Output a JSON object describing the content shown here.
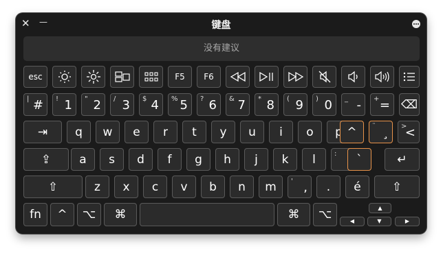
{
  "window": {
    "title": "键盘",
    "close_glyph": "✕",
    "minimize_glyph": "—"
  },
  "suggestion_bar": {
    "text": "没有建议"
  },
  "function_row": {
    "esc": "esc",
    "f5": "F5",
    "f6": "F6",
    "icons": [
      "brightness-down-icon",
      "brightness-up-icon",
      "mission-control-icon",
      "launchpad-icon",
      "rewind-icon",
      "play-pause-icon",
      "fast-forward-icon",
      "mute-icon",
      "volume-down-icon",
      "volume-up-icon",
      "list-icon"
    ]
  },
  "number_row": [
    {
      "sec": "|",
      "pri": "#"
    },
    {
      "sec": "!",
      "pri": "1"
    },
    {
      "sec": "\"",
      "pri": "2"
    },
    {
      "sec": "/",
      "pri": "3"
    },
    {
      "sec": "$",
      "pri": "4"
    },
    {
      "sec": "%",
      "pri": "5"
    },
    {
      "sec": "?",
      "pri": "6"
    },
    {
      "sec": "&",
      "pri": "7"
    },
    {
      "sec": "*",
      "pri": "8"
    },
    {
      "sec": "(",
      "pri": "9"
    },
    {
      "sec": ")",
      "pri": "0"
    },
    {
      "sec": "_",
      "pri": "-"
    },
    {
      "sec": "+",
      "pri": "="
    }
  ],
  "qwerty_row": [
    "q",
    "w",
    "e",
    "r",
    "t",
    "y",
    "u",
    "i",
    "o",
    "p",
    "^",
    "¸",
    "<"
  ],
  "qwerty_row_secondary": {
    "diaeresis": "¨",
    "gt": ">"
  },
  "home_row": [
    "a",
    "s",
    "d",
    "f",
    "g",
    "h",
    "j",
    "k",
    "l",
    ";",
    "`"
  ],
  "home_row_secondary": {
    "colon": ":"
  },
  "bottom_letters": [
    "z",
    "x",
    "c",
    "v",
    "b",
    "n",
    "m",
    ",",
    ".",
    "é"
  ],
  "bottom_letters_secondary": {
    "quote": "'"
  },
  "modifier_row": {
    "fn": "fn",
    "control": "^",
    "option": "⌥",
    "command": "⌘",
    "arrow_up": "▲",
    "arrow_left": "◀",
    "arrow_down": "▼",
    "arrow_right": "▶"
  },
  "glyphs": {
    "tab": "⇥",
    "shift": "⇧",
    "caps": "⇪",
    "return": "↵",
    "delete": "⌫"
  },
  "colors": {
    "window_bg": "#1b1b1b",
    "key_bg": "#2b2b2b",
    "key_border": "#5a5a5a",
    "highlight": "#e8934a"
  }
}
